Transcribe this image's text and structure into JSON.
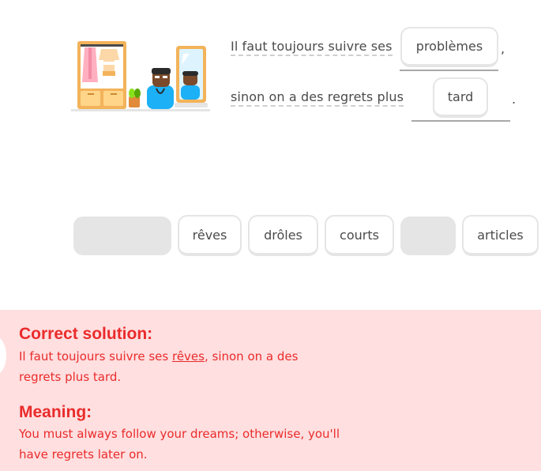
{
  "exercise": {
    "line1_text": "Il faut toujours suivre ses",
    "line1_answer": "problèmes",
    "line1_punct": ",",
    "line2_text": "sinon on a des regrets plus",
    "line2_answer": "tard",
    "line2_punct": "."
  },
  "word_bank": {
    "words": [
      "rêves",
      "drôles",
      "courts",
      "articles"
    ]
  },
  "feedback": {
    "heading_solution": "Correct solution:",
    "solution_before": "Il faut toujours suivre ses ",
    "solution_highlight": "rêves",
    "solution_after": ", sinon on a des",
    "solution_line2": "regrets plus tard.",
    "heading_meaning": "Meaning:",
    "meaning_line1": "You must always follow your dreams; otherwise, you'll",
    "meaning_line2": "have regrets later on."
  },
  "colors": {
    "feedback_bg": "#ffdfe0",
    "feedback_text": "#ea2b2b",
    "chip_border": "#e5e5e5",
    "text": "#4b4b4b"
  },
  "icons": {
    "illustration": "wardrobe-mirror-character-illustration"
  }
}
